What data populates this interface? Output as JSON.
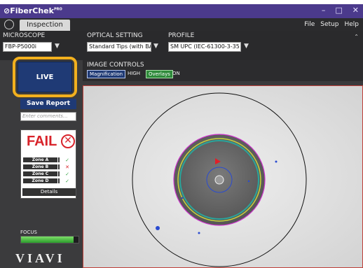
{
  "app": {
    "title": "FiberChek",
    "title_suffix": "PRO",
    "window_controls": [
      "–",
      "□",
      "✕"
    ]
  },
  "tabs": {
    "inspection_label": "Inspection"
  },
  "menu": {
    "items": [
      "File",
      "Setup",
      "Help"
    ]
  },
  "toolbar": {
    "microscope_label": "MICROSCOPE",
    "microscope_value": "FBP-P5000i",
    "optical_label": "OPTICAL SETTING",
    "optical_value": "Standard Tips (with BAP1)",
    "profile_label": "PROFILE",
    "profile_value": "SM UPC (IEC-61300-3-35 Ed. 2.0)",
    "image_controls_label": "IMAGE CONTROLS",
    "magnification_btn": "Magnification",
    "magnification_value": "HIGH",
    "overlays_btn": "Overlays",
    "overlays_value": "ON"
  },
  "sidebar": {
    "live_label": "LIVE",
    "save_report_label": "Save Report",
    "comments_placeholder": "Enter comments..."
  },
  "result": {
    "overall": "FAIL",
    "zones": [
      {
        "name": "Zone A",
        "status": "pass"
      },
      {
        "name": "Zone B",
        "status": "fail"
      },
      {
        "name": "Zone C",
        "status": "pass"
      },
      {
        "name": "Zone D",
        "status": "pass"
      }
    ],
    "details_label": "Details"
  },
  "focus": {
    "label": "FOCUS",
    "level": 0.92
  },
  "brand": {
    "logo": "VIAVI"
  },
  "colors": {
    "titlebar": "#4b3a8c",
    "accent_blue": "#1f3a75",
    "fail_red": "#d8232a",
    "pass_green": "#3aa64a",
    "highlight": "#f2b01e",
    "overlay_yellow_green": "#c8d63a",
    "overlay_magenta": "#cc33cc",
    "overlay_blue": "#2a4bd0",
    "overlay_teal": "#2aa59a"
  }
}
